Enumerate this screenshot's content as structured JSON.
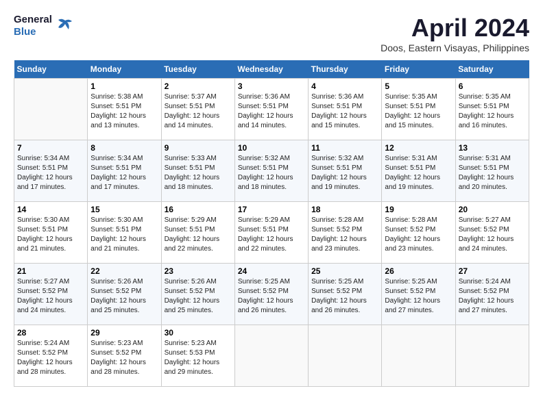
{
  "header": {
    "logo_line1": "General",
    "logo_line2": "Blue",
    "month": "April 2024",
    "location": "Doos, Eastern Visayas, Philippines"
  },
  "days_of_week": [
    "Sunday",
    "Monday",
    "Tuesday",
    "Wednesday",
    "Thursday",
    "Friday",
    "Saturday"
  ],
  "weeks": [
    [
      {
        "day": "",
        "info": ""
      },
      {
        "day": "1",
        "info": "Sunrise: 5:38 AM\nSunset: 5:51 PM\nDaylight: 12 hours\nand 13 minutes."
      },
      {
        "day": "2",
        "info": "Sunrise: 5:37 AM\nSunset: 5:51 PM\nDaylight: 12 hours\nand 14 minutes."
      },
      {
        "day": "3",
        "info": "Sunrise: 5:36 AM\nSunset: 5:51 PM\nDaylight: 12 hours\nand 14 minutes."
      },
      {
        "day": "4",
        "info": "Sunrise: 5:36 AM\nSunset: 5:51 PM\nDaylight: 12 hours\nand 15 minutes."
      },
      {
        "day": "5",
        "info": "Sunrise: 5:35 AM\nSunset: 5:51 PM\nDaylight: 12 hours\nand 15 minutes."
      },
      {
        "day": "6",
        "info": "Sunrise: 5:35 AM\nSunset: 5:51 PM\nDaylight: 12 hours\nand 16 minutes."
      }
    ],
    [
      {
        "day": "7",
        "info": "Sunrise: 5:34 AM\nSunset: 5:51 PM\nDaylight: 12 hours\nand 17 minutes."
      },
      {
        "day": "8",
        "info": "Sunrise: 5:34 AM\nSunset: 5:51 PM\nDaylight: 12 hours\nand 17 minutes."
      },
      {
        "day": "9",
        "info": "Sunrise: 5:33 AM\nSunset: 5:51 PM\nDaylight: 12 hours\nand 18 minutes."
      },
      {
        "day": "10",
        "info": "Sunrise: 5:32 AM\nSunset: 5:51 PM\nDaylight: 12 hours\nand 18 minutes."
      },
      {
        "day": "11",
        "info": "Sunrise: 5:32 AM\nSunset: 5:51 PM\nDaylight: 12 hours\nand 19 minutes."
      },
      {
        "day": "12",
        "info": "Sunrise: 5:31 AM\nSunset: 5:51 PM\nDaylight: 12 hours\nand 19 minutes."
      },
      {
        "day": "13",
        "info": "Sunrise: 5:31 AM\nSunset: 5:51 PM\nDaylight: 12 hours\nand 20 minutes."
      }
    ],
    [
      {
        "day": "14",
        "info": "Sunrise: 5:30 AM\nSunset: 5:51 PM\nDaylight: 12 hours\nand 21 minutes."
      },
      {
        "day": "15",
        "info": "Sunrise: 5:30 AM\nSunset: 5:51 PM\nDaylight: 12 hours\nand 21 minutes."
      },
      {
        "day": "16",
        "info": "Sunrise: 5:29 AM\nSunset: 5:51 PM\nDaylight: 12 hours\nand 22 minutes."
      },
      {
        "day": "17",
        "info": "Sunrise: 5:29 AM\nSunset: 5:51 PM\nDaylight: 12 hours\nand 22 minutes."
      },
      {
        "day": "18",
        "info": "Sunrise: 5:28 AM\nSunset: 5:52 PM\nDaylight: 12 hours\nand 23 minutes."
      },
      {
        "day": "19",
        "info": "Sunrise: 5:28 AM\nSunset: 5:52 PM\nDaylight: 12 hours\nand 23 minutes."
      },
      {
        "day": "20",
        "info": "Sunrise: 5:27 AM\nSunset: 5:52 PM\nDaylight: 12 hours\nand 24 minutes."
      }
    ],
    [
      {
        "day": "21",
        "info": "Sunrise: 5:27 AM\nSunset: 5:52 PM\nDaylight: 12 hours\nand 24 minutes."
      },
      {
        "day": "22",
        "info": "Sunrise: 5:26 AM\nSunset: 5:52 PM\nDaylight: 12 hours\nand 25 minutes."
      },
      {
        "day": "23",
        "info": "Sunrise: 5:26 AM\nSunset: 5:52 PM\nDaylight: 12 hours\nand 25 minutes."
      },
      {
        "day": "24",
        "info": "Sunrise: 5:25 AM\nSunset: 5:52 PM\nDaylight: 12 hours\nand 26 minutes."
      },
      {
        "day": "25",
        "info": "Sunrise: 5:25 AM\nSunset: 5:52 PM\nDaylight: 12 hours\nand 26 minutes."
      },
      {
        "day": "26",
        "info": "Sunrise: 5:25 AM\nSunset: 5:52 PM\nDaylight: 12 hours\nand 27 minutes."
      },
      {
        "day": "27",
        "info": "Sunrise: 5:24 AM\nSunset: 5:52 PM\nDaylight: 12 hours\nand 27 minutes."
      }
    ],
    [
      {
        "day": "28",
        "info": "Sunrise: 5:24 AM\nSunset: 5:52 PM\nDaylight: 12 hours\nand 28 minutes."
      },
      {
        "day": "29",
        "info": "Sunrise: 5:23 AM\nSunset: 5:52 PM\nDaylight: 12 hours\nand 28 minutes."
      },
      {
        "day": "30",
        "info": "Sunrise: 5:23 AM\nSunset: 5:53 PM\nDaylight: 12 hours\nand 29 minutes."
      },
      {
        "day": "",
        "info": ""
      },
      {
        "day": "",
        "info": ""
      },
      {
        "day": "",
        "info": ""
      },
      {
        "day": "",
        "info": ""
      }
    ]
  ]
}
